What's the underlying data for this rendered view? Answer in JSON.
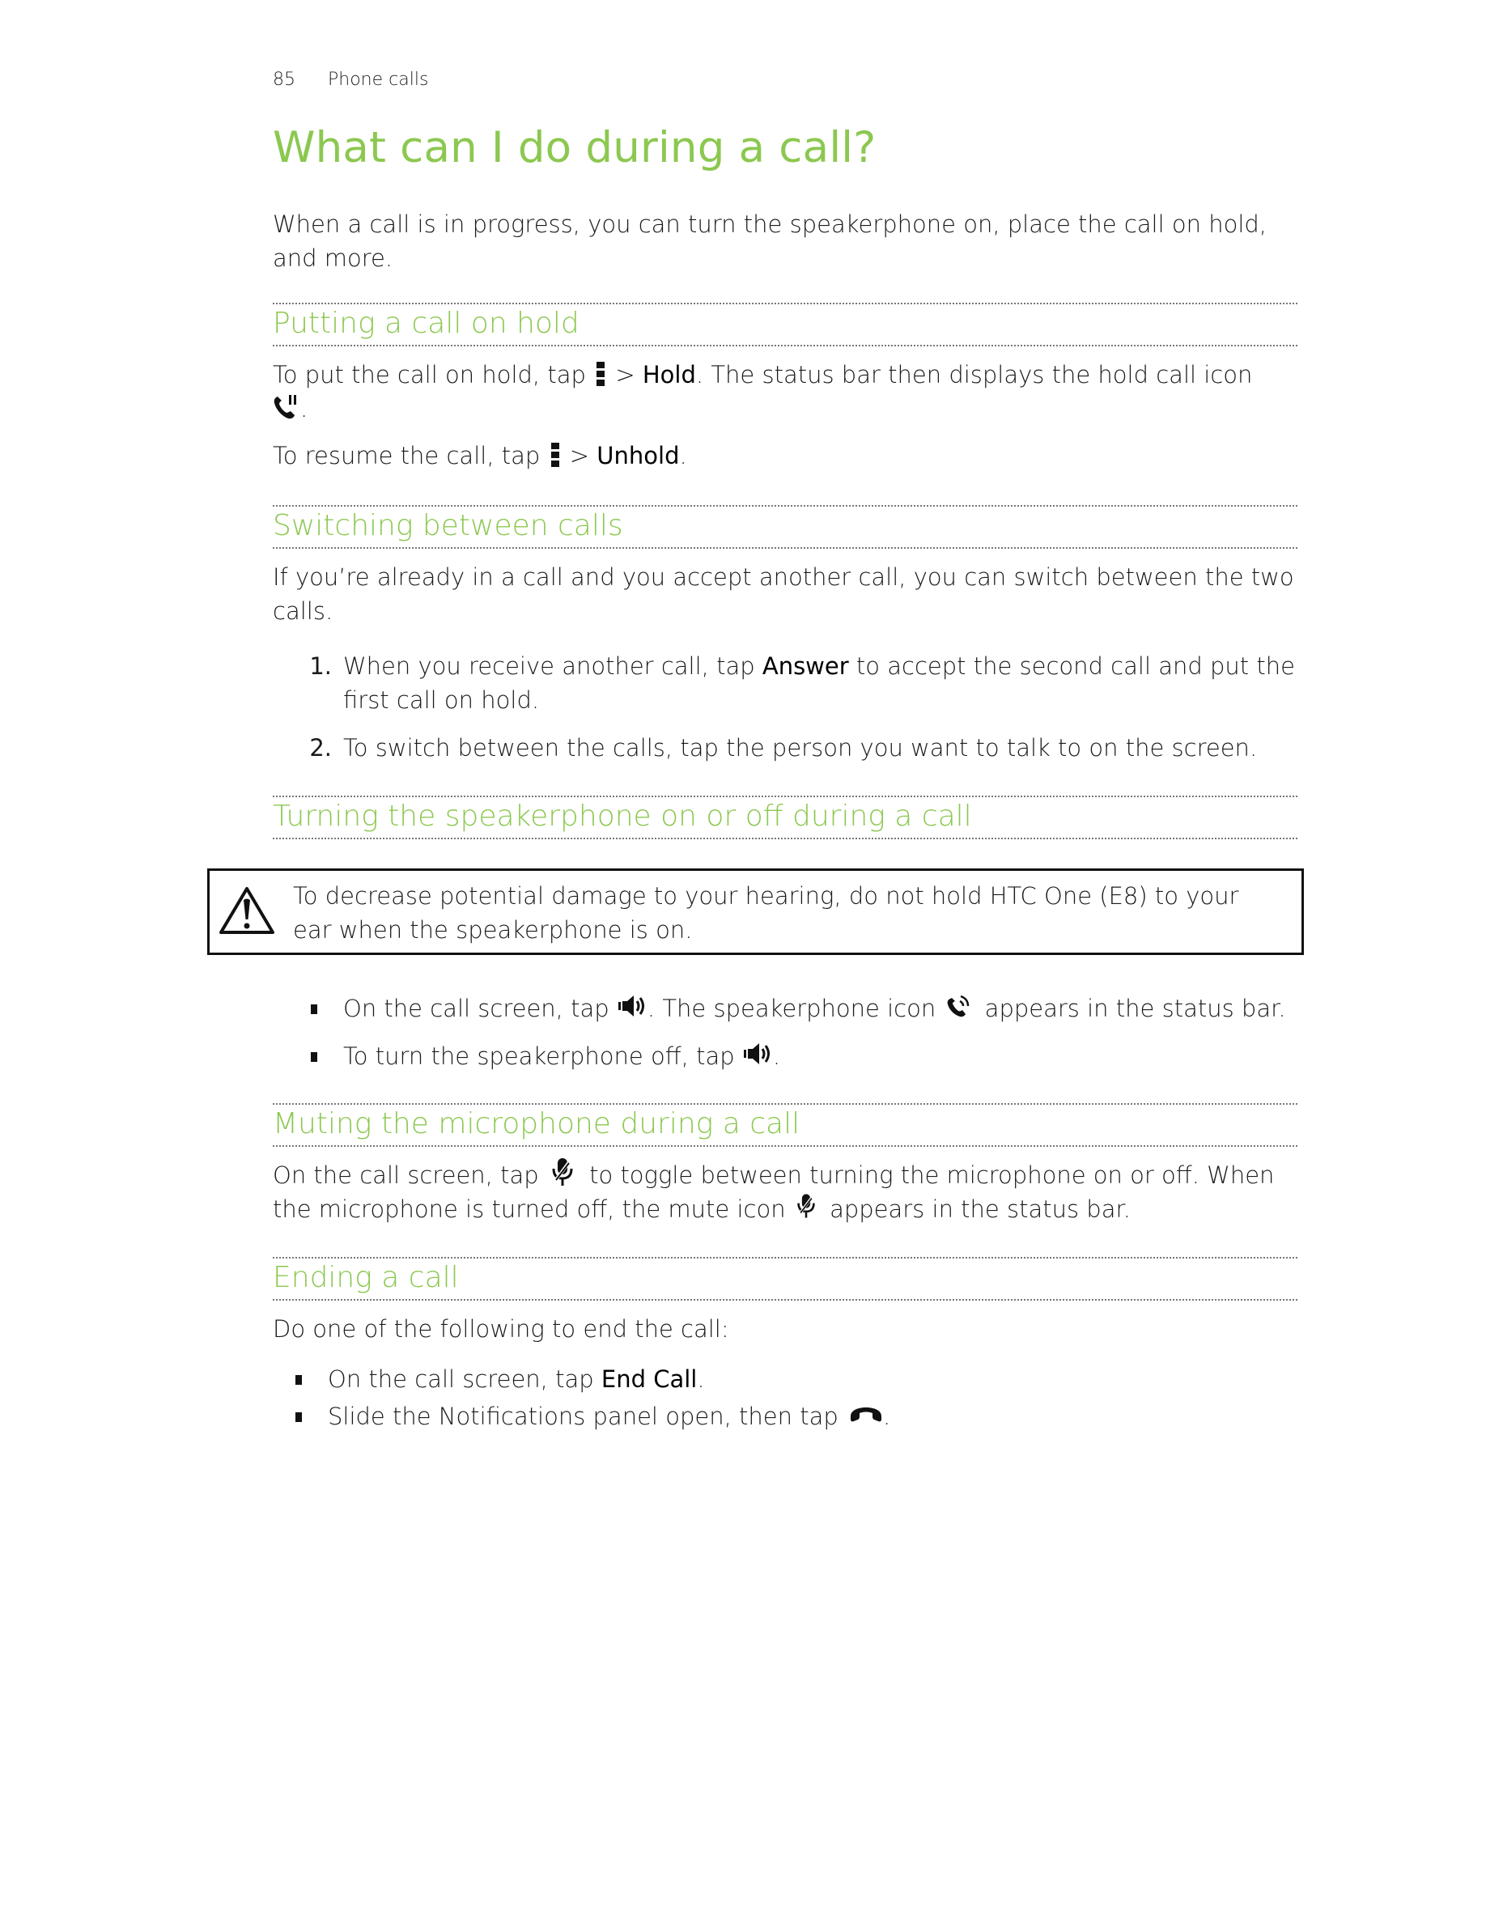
{
  "header": {
    "page_number": "85",
    "chapter": "Phone calls"
  },
  "title": "What can I do during a call?",
  "intro": "When a call is in progress, you can turn the speakerphone on, place the call on hold, and more.",
  "accent_color": "#8cc850",
  "sections": {
    "hold": {
      "heading": "Putting a call on hold",
      "p1_before": "To put the call on hold, tap",
      "p1_menu_sep": ">",
      "p1_action": "Hold",
      "p1_after": ". The status bar then displays the hold call icon",
      "p1_end": ".",
      "p2_before": "To resume the call, tap",
      "p2_menu_sep": ">",
      "p2_action": "Unhold",
      "p2_end": ".",
      "icons": [
        "menu-icon",
        "hold-call-icon"
      ]
    },
    "switching": {
      "heading": "Switching between calls",
      "intro": "If you’re already in a call and you accept another call, you can switch between the two calls.",
      "steps": [
        {
          "number": "1.",
          "before": "When you receive another call, tap",
          "action": "Answer",
          "after": "to accept the second call and put the first call on hold."
        },
        {
          "number": "2.",
          "text": "To switch between the calls, tap the person you want to talk to on the screen."
        }
      ]
    },
    "speakerphone": {
      "heading": "Turning the speakerphone on or off during a call",
      "warning": "To decrease potential damage to your hearing, do not hold HTC One (E8) to your ear when the speakerphone is on.",
      "bullets": [
        {
          "before": "On the call screen, tap",
          "middle": ". The speakerphone icon",
          "after": "appears in the status bar."
        },
        {
          "before": "To turn the speakerphone off, tap",
          "after": "."
        }
      ],
      "icons": [
        "warning-icon",
        "speaker-icon",
        "speakerphone-status-icon"
      ]
    },
    "mute": {
      "heading": "Muting the microphone during a call",
      "before": "On the call screen, tap",
      "middle": "to toggle between turning the microphone on or off. When the microphone is turned off, the mute icon",
      "after": "appears in the status bar.",
      "icons": [
        "mute-microphone-icon"
      ]
    },
    "ending": {
      "heading": "Ending a call",
      "intro": "Do one of the following to end the call:",
      "bullets": [
        {
          "before": "On the call screen, tap",
          "action": "End Call",
          "after": "."
        },
        {
          "before": "Slide the Notifications panel open, then tap",
          "after": "."
        }
      ],
      "icons": [
        "end-call-icon"
      ]
    }
  }
}
